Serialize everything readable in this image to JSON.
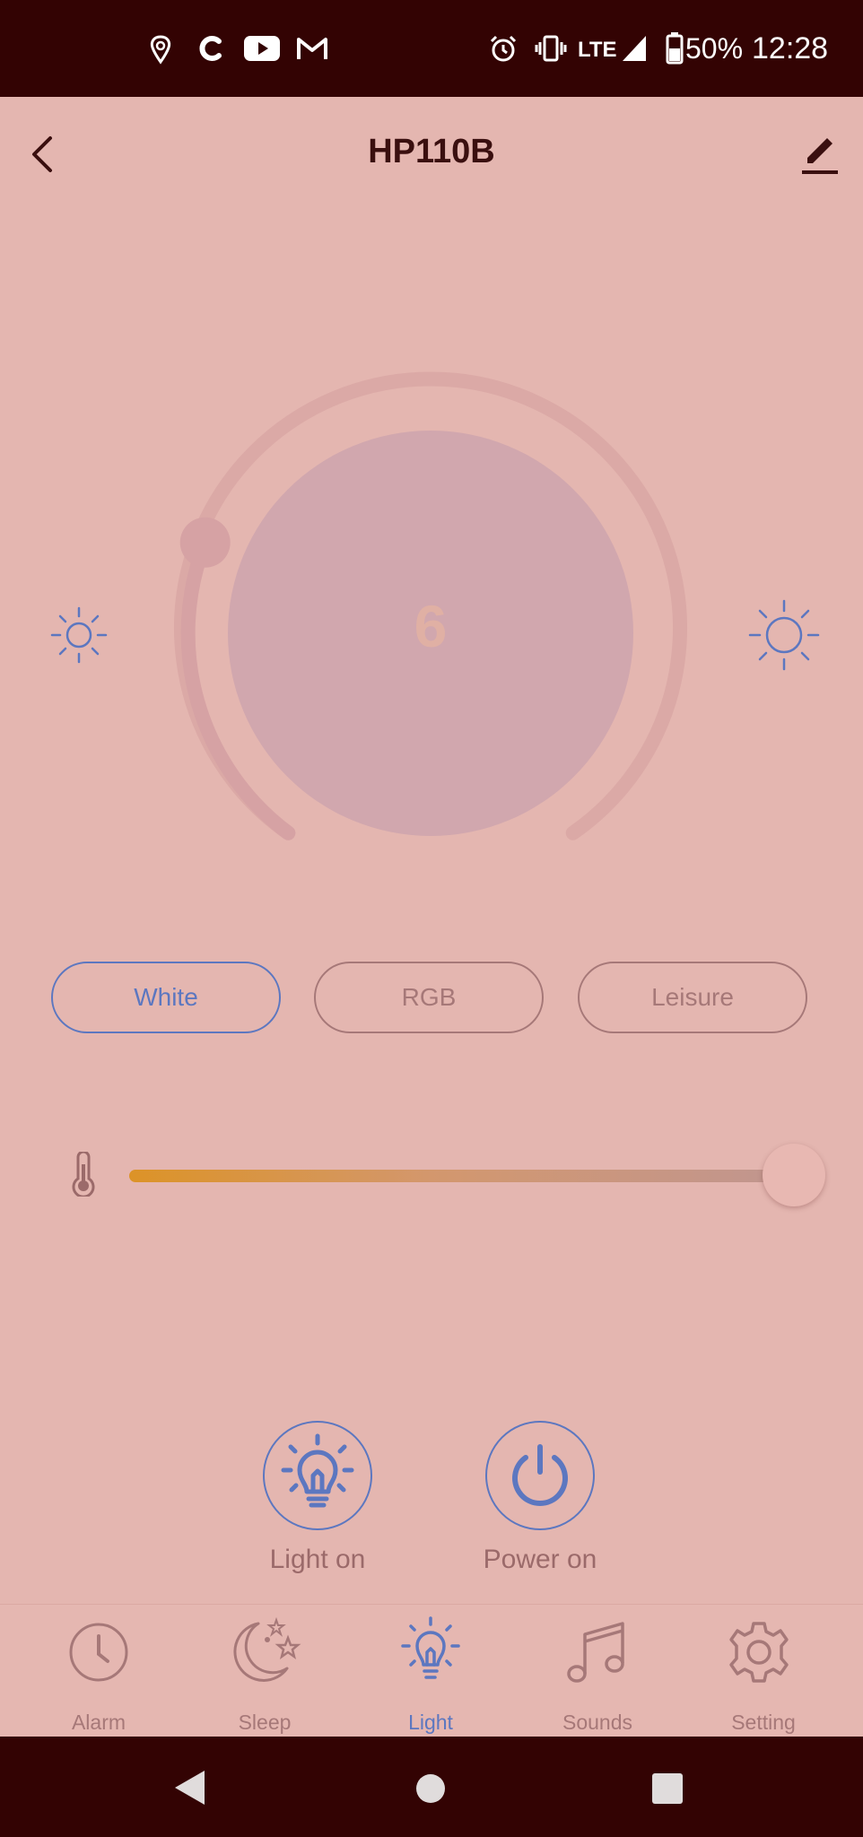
{
  "status_bar": {
    "time": "12:28",
    "battery": "50%",
    "network": "LTE"
  },
  "header": {
    "title": "HP110B"
  },
  "dial": {
    "value": "6"
  },
  "modes": [
    {
      "label": "White",
      "active": true
    },
    {
      "label": "RGB",
      "active": false
    },
    {
      "label": "Leisure",
      "active": false
    }
  ],
  "color_temperature": {
    "level": 1.0
  },
  "actions": {
    "light_label": "Light on",
    "power_label": "Power on"
  },
  "tabs": [
    {
      "label": "Alarm",
      "icon": "clock-icon"
    },
    {
      "label": "Sleep",
      "icon": "moon-stars-icon"
    },
    {
      "label": "Light",
      "icon": "bulb-icon",
      "active": true
    },
    {
      "label": "Sounds",
      "icon": "music-note-icon"
    },
    {
      "label": "Setting",
      "icon": "gear-icon"
    }
  ],
  "colors": {
    "background": "#e4b6b0",
    "accent": "#5c77c0",
    "muted": "#a67878",
    "bars": "#330303",
    "slider_warm": "#dc9327"
  }
}
